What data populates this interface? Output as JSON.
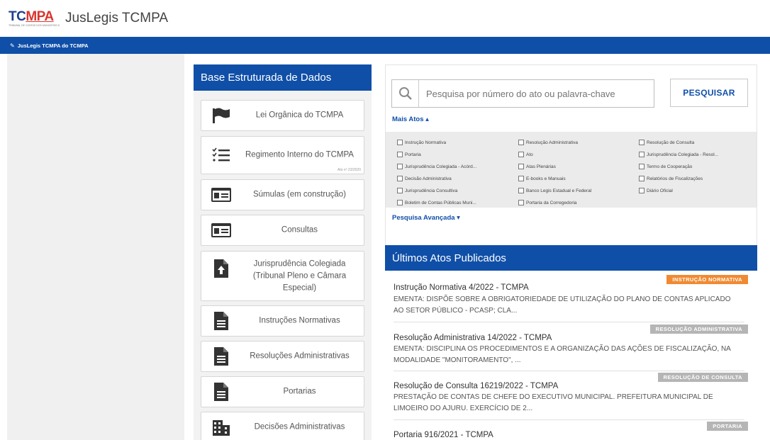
{
  "header": {
    "logo_text_1": "TC",
    "logo_text_2": "MPA",
    "logo_sub": "TRIBUNAL DE CONTAS DOS MUNICÍPIOS DO ESTADO DO PARÁ",
    "app_title": "JusLegis TCMPA"
  },
  "navbar": {
    "breadcrumb": "JusLegis TCMPA do TCMPA"
  },
  "base": {
    "title": "Base Estruturada de Dados",
    "items": [
      {
        "label": "Lei Orgânica do TCMPA",
        "icon": "flag-icon"
      },
      {
        "label": "Regimento Interno do TCMPA",
        "icon": "list-icon",
        "note": "Ato nº 23/2020"
      },
      {
        "label": "Súmulas (em construção)",
        "icon": "id-card-icon"
      },
      {
        "label": "Consultas",
        "icon": "id-card-icon"
      },
      {
        "label": "Jurisprudência Colegiada (Tribunal Pleno e Câmara Especial)",
        "icon": "file-upload-icon"
      },
      {
        "label": "Instruções Normativas",
        "icon": "document-icon"
      },
      {
        "label": "Resoluções Administrativas",
        "icon": "document-icon"
      },
      {
        "label": "Portarias",
        "icon": "document-icon"
      },
      {
        "label": "Decisões Administrativas",
        "icon": "building-icon"
      }
    ]
  },
  "search": {
    "placeholder": "Pesquisa por número do ato ou palavra-chave",
    "button": "PESQUISAR",
    "mais_atos": "Mais Atos ▴",
    "pesquisa_avancada": "Pesquisa Avançada ▾",
    "filters": [
      "Instrução Normativa",
      "Resolução Administrativa",
      "Resolução de Consulta",
      "Portaria",
      "Ato",
      "Jurisprudência Colegiada - Resol...",
      "Jurisprudência Colegiada - Acórd...",
      "Atas Plenárias",
      "Termo de Cooperação",
      "Decisão Administrativa",
      "E-books e Manuais",
      "Relatórios de Fiscalizações",
      "Jurisprudência Consultiva",
      "Banco Legis Estadual e Federal",
      "Diário Oficial",
      "Boletim de Contas Públicas Muni...",
      "Portaria da Corregedoria"
    ]
  },
  "atos": {
    "title": "Últimos Atos Publicados",
    "items": [
      {
        "badge": "INSTRUÇÃO NORMATIVA",
        "badge_color": "#f08a32",
        "title": "Instrução Normativa 4/2022 - TCMPA",
        "desc": "EMENTA: DISPÕE SOBRE A OBRIGATORIEDADE DE UTILIZAÇÃO DO PLANO DE CONTAS APLICADO AO SETOR PÚBLICO - PCASP; CLA..."
      },
      {
        "badge": "RESOLUÇÃO ADMINISTRATIVA",
        "badge_color": "#b5b5b5",
        "title": "Resolução Administrativa 14/2022 - TCMPA",
        "desc": "EMENTA: DISCIPLINA OS PROCEDIMENTOS E A ORGANIZAÇÃO DAS AÇÕES DE FISCALIZAÇÃO, NA MODALIDADE \"MONITORAMENTO\", ..."
      },
      {
        "badge": "RESOLUÇÃO DE CONSULTA",
        "badge_color": "#b5b5b5",
        "title": "Resolução de Consulta 16219/2022 - TCMPA",
        "desc": "PRESTAÇÃO DE CONTAS DE CHEFE DO EXECUTIVO MUNICIPAL. PREFEITURA MUNICIPAL DE LIMOEIRO DO AJURU. EXERCÍCIO DE 2..."
      },
      {
        "badge": "PORTARIA",
        "badge_color": "#b5b5b5",
        "title": "Portaria 916/2021 - TCMPA",
        "desc": ""
      }
    ]
  },
  "colors": {
    "brand_blue": "#0f4fa8",
    "accent_orange": "#f08a32",
    "badge_gray": "#b5b5b5"
  }
}
